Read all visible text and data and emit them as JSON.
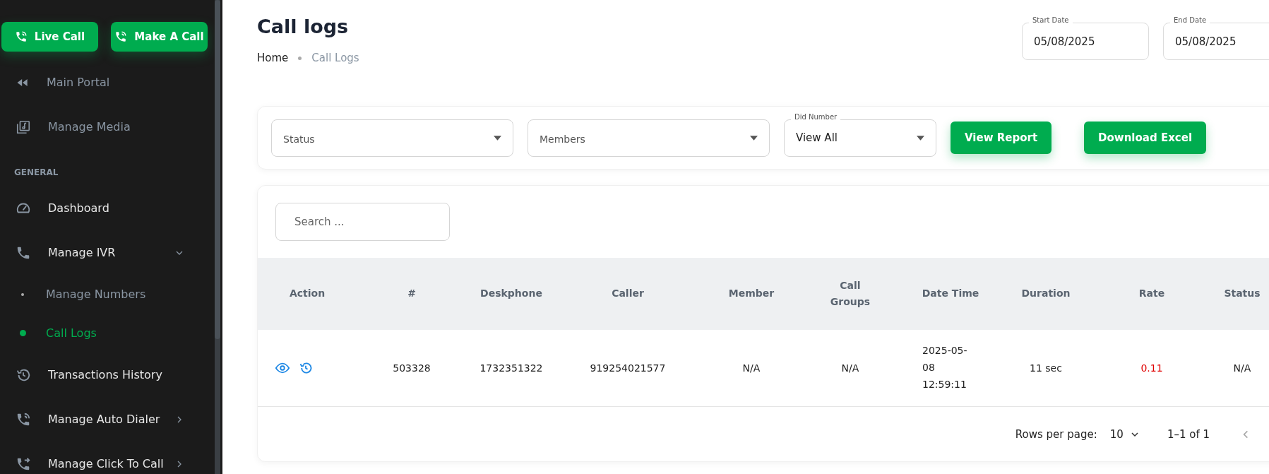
{
  "sidebar": {
    "top_buttons": [
      {
        "label": "Live Call"
      },
      {
        "label": "Make A Call"
      }
    ],
    "portal_links": [
      {
        "label": "Main Portal"
      },
      {
        "label": "Manage Media"
      }
    ],
    "section_title": "GENERAL",
    "items": [
      {
        "label": "Dashboard"
      },
      {
        "label": "Manage IVR",
        "expanded": true,
        "children": [
          {
            "label": "Manage Numbers",
            "selected": false
          },
          {
            "label": "Call Logs",
            "selected": true
          }
        ]
      },
      {
        "label": "Transactions History"
      },
      {
        "label": "Manage Auto Dialer",
        "expanded": false
      },
      {
        "label": "Manage Click To Call",
        "expanded": false
      }
    ]
  },
  "page": {
    "title": "Call logs",
    "breadcrumb": [
      "Home",
      "Call Logs"
    ],
    "date_fields": [
      {
        "label": "Start Date",
        "value": "05/08/2025"
      },
      {
        "label": "End Date",
        "value": "05/08/2025"
      }
    ]
  },
  "filters": {
    "selects": [
      {
        "placeholder": "Status"
      },
      {
        "placeholder": "Members"
      },
      {
        "label": "Did Number",
        "value": "View All"
      }
    ],
    "buttons": [
      "View Report",
      "Download Excel"
    ]
  },
  "table": {
    "search": {
      "placeholder": "Search ..."
    },
    "columns": [
      "Action",
      "#",
      "Deskphone",
      "Caller",
      "Member",
      "Call Groups",
      "Date Time",
      "Duration",
      "Rate",
      "Status"
    ],
    "rows": [
      {
        "id": "503328",
        "deskphone": "1732351322",
        "caller": "919254021577",
        "member": "N/A",
        "call_groups": "N/A",
        "date_time": "2025-05-08 12:59:11",
        "duration": "11 sec",
        "rate": "0.11",
        "status": "N/A"
      }
    ],
    "pagination": {
      "rows_per_page_label": "Rows per page:",
      "rows_per_page": "10",
      "range": "1–1 of 1"
    }
  }
}
